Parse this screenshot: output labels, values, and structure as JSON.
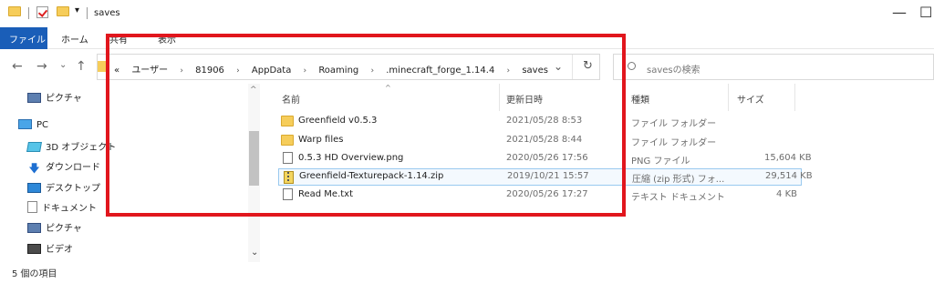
{
  "window": {
    "title": "saves",
    "qa_arrow": "▾",
    "minimize": "—",
    "maximize": "☐"
  },
  "ribbon": {
    "file": "ファイル",
    "home": "ホーム",
    "share": "共有",
    "view": "表示"
  },
  "nav": {
    "back": "←",
    "forward": "→",
    "recent": "⌄",
    "up": "↑"
  },
  "address": {
    "overflow": "«",
    "crumbs": [
      "ユーザー",
      "81906",
      "AppData",
      "Roaming",
      ".minecraft_forge_1.14.4",
      "saves"
    ],
    "separator": "›",
    "dropdown": "⌄",
    "refresh": "↻"
  },
  "search": {
    "placeholder": "savesの検索"
  },
  "sidebar": {
    "items": [
      {
        "label": "ピクチャ",
        "icon": "pictures-icon"
      },
      {
        "label": "PC",
        "icon": "pc-icon"
      },
      {
        "label": "3D オブジェクト",
        "icon": "3d-objects-icon"
      },
      {
        "label": "ダウンロード",
        "icon": "download-icon"
      },
      {
        "label": "デスクトップ",
        "icon": "desktop-icon"
      },
      {
        "label": "ドキュメント",
        "icon": "document-icon"
      },
      {
        "label": "ピクチャ",
        "icon": "pictures-icon"
      },
      {
        "label": "ビデオ",
        "icon": "video-icon"
      }
    ],
    "scroll_up": "^",
    "scroll_down": "⌄"
  },
  "columns": {
    "name": "名前",
    "date": "更新日時",
    "type": "種類",
    "size": "サイズ",
    "sort_indicator": "^"
  },
  "files": [
    {
      "name": "Greenfield v0.5.3",
      "date": "2021/05/28 8:53",
      "type": "ファイル フォルダー",
      "size": "",
      "icon": "folder-icon"
    },
    {
      "name": "Warp files",
      "date": "2021/05/28 8:44",
      "type": "ファイル フォルダー",
      "size": "",
      "icon": "folder-icon"
    },
    {
      "name": "0.5.3 HD Overview.png",
      "date": "2020/05/26 17:56",
      "type": "PNG ファイル",
      "size": "15,604 KB",
      "icon": "png-file-icon"
    },
    {
      "name": "Greenfield-Texturepack-1.14.zip",
      "date": "2019/10/21 15:57",
      "type": "圧縮 (zip 形式) フォ...",
      "size": "29,514 KB",
      "icon": "zip-file-icon"
    },
    {
      "name": "Read Me.txt",
      "date": "2020/05/26 17:27",
      "type": "テキスト ドキュメント",
      "size": "4 KB",
      "icon": "text-file-icon"
    }
  ],
  "status": {
    "count": "5 個の項目"
  },
  "colors": {
    "accent": "#1a5eb8",
    "annotation": "#e1161d",
    "selection": "#99c9ef"
  }
}
